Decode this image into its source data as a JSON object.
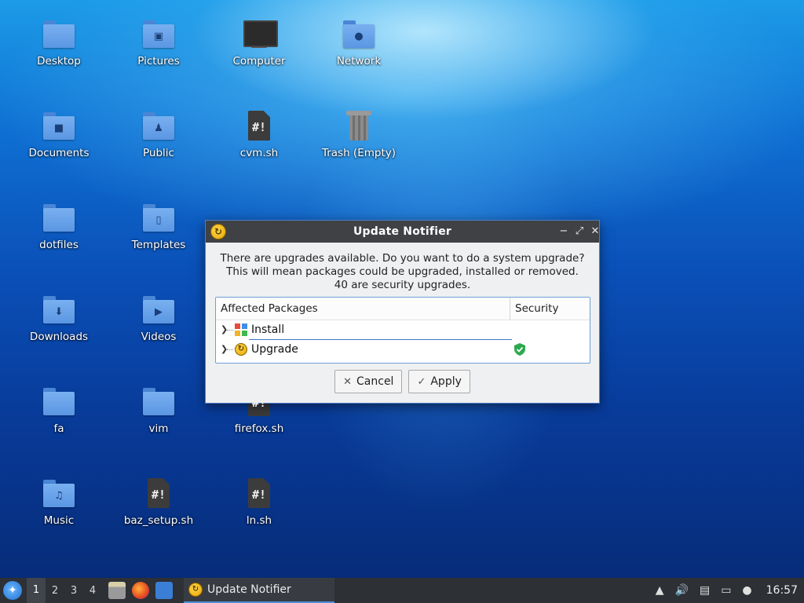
{
  "desktop": {
    "icons": [
      {
        "label": "Desktop",
        "type": "folder",
        "emblem": ""
      },
      {
        "label": "Pictures",
        "type": "folder",
        "emblem": "▣"
      },
      {
        "label": "Computer",
        "type": "monitor"
      },
      {
        "label": "Network",
        "type": "folder",
        "emblem": "●"
      },
      {
        "label": "Documents",
        "type": "folder",
        "emblem": "■"
      },
      {
        "label": "Public",
        "type": "folder",
        "emblem": "♟"
      },
      {
        "label": "cvm.sh",
        "type": "script"
      },
      {
        "label": "Trash (Empty)",
        "type": "trash"
      },
      {
        "label": "dotfiles",
        "type": "folder",
        "emblem": ""
      },
      {
        "label": "Templates",
        "type": "folder",
        "emblem": "▯"
      },
      {
        "label": "Downloads",
        "type": "folder",
        "emblem": "⬇"
      },
      {
        "label": "Videos",
        "type": "folder",
        "emblem": "▶"
      },
      {
        "label": "fa",
        "type": "folder",
        "emblem": ""
      },
      {
        "label": "vim",
        "type": "folder",
        "emblem": ""
      },
      {
        "label": "firefox.sh",
        "type": "script"
      },
      {
        "label": "Music",
        "type": "folder",
        "emblem": "♫"
      },
      {
        "label": "baz_setup.sh",
        "type": "script"
      },
      {
        "label": "ln.sh",
        "type": "script"
      }
    ],
    "script_glyph": "#!"
  },
  "dialog": {
    "title": "Update Notifier",
    "message_line1": "There are upgrades available. Do you want to do a system upgrade?",
    "message_line2": "This will mean packages could be upgraded, installed or removed.",
    "message_line3": "40 are security upgrades.",
    "columns": {
      "packages": "Affected Packages",
      "security": "Security"
    },
    "rows": [
      {
        "label": "Install",
        "security": false
      },
      {
        "label": "Upgrade",
        "security": true
      }
    ],
    "buttons": {
      "cancel": "Cancel",
      "apply": "Apply"
    },
    "accent": "#4d7fc5"
  },
  "taskbar": {
    "workspaces": [
      "1",
      "2",
      "3",
      "4"
    ],
    "active_workspace": "1",
    "task_label": "Update Notifier",
    "clock": "16:57"
  }
}
